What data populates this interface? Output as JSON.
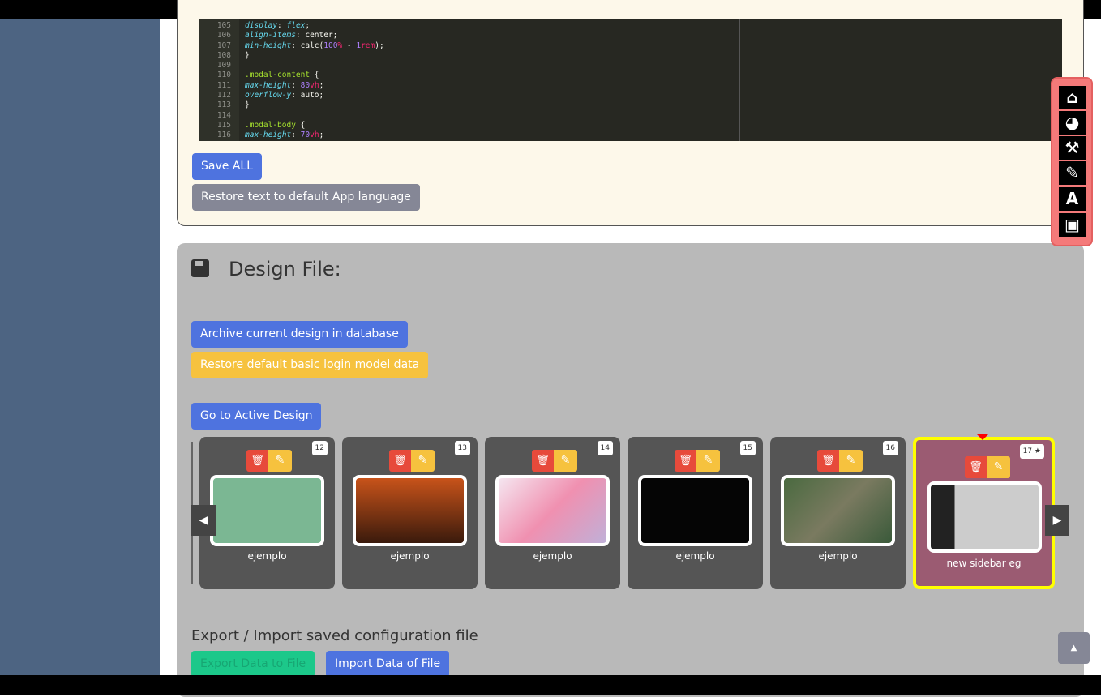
{
  "editor": {
    "lines": [
      "105",
      "106",
      "107",
      "108",
      "109",
      "110",
      "111",
      "112",
      "113",
      "114",
      "115",
      "116"
    ]
  },
  "buttons": {
    "save_all": "Save ALL",
    "restore_text": "Restore text to default App language",
    "archive": "Archive current design in database",
    "restore_default": "Restore default basic login model data",
    "go_active": "Go to Active Design",
    "export": "Export Data to File",
    "import": "Import Data of File"
  },
  "design": {
    "title": "Design File:",
    "export_heading": "Export / Import saved configuration file",
    "cards": [
      {
        "num": "12",
        "name": "ejemplo"
      },
      {
        "num": "13",
        "name": "ejemplo"
      },
      {
        "num": "14",
        "name": "ejemplo"
      },
      {
        "num": "15",
        "name": "ejemplo"
      },
      {
        "num": "16",
        "name": "ejemplo"
      },
      {
        "num": "17 ★",
        "name": "new sidebar eg",
        "active": true
      }
    ]
  },
  "toolbar": [
    "home-icon",
    "palette-icon",
    "wrench-icon",
    "paintbrush-icon",
    "font-icon",
    "save-icon"
  ],
  "colors": {
    "primary": "#4e73df",
    "danger": "#e74a3b",
    "warning": "#f6c23e",
    "success": "#1cc88a",
    "active_card": "#9b5b72",
    "active_border": "#ffff00"
  }
}
